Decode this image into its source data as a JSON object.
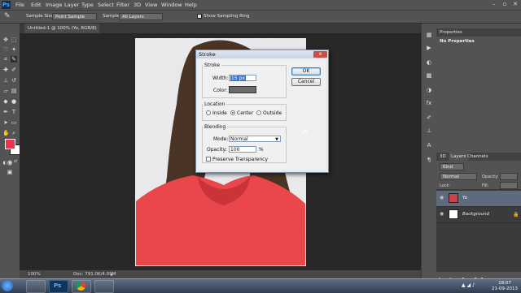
{
  "app": {
    "logo": "Ps"
  },
  "menu": [
    "File",
    "Edit",
    "Image",
    "Layer",
    "Type",
    "Select",
    "Filter",
    "3D",
    "View",
    "Window",
    "Help"
  ],
  "options_bar": {
    "sample_size_label": "Sample Size:",
    "sample_size_value": "Point Sample",
    "sample_label": "Sample:",
    "sample_value": "All Layers",
    "show_ring_label": "Show Sampling Ring"
  },
  "document_tab": "Untitled-1 @ 100% (Yo, RGB/8) *",
  "status": {
    "zoom": "100%",
    "doc": "Doc: 791.0K/4.09M"
  },
  "dialog": {
    "title": "Stroke",
    "close": "x",
    "stroke_group": "Stroke",
    "width_label": "Width:",
    "width_value": "15 px",
    "color_label": "Color:",
    "color_swatch": "#6b6b6b",
    "location_group": "Location",
    "location_options": [
      "Inside",
      "Center",
      "Outside"
    ],
    "location_selected": "Center",
    "blending_group": "Blending",
    "mode_label": "Mode:",
    "mode_value": "Normal",
    "opacity_label": "Opacity:",
    "opacity_value": "100",
    "opacity_unit": "%",
    "preserve_label": "Preserve Transparency",
    "ok_label": "OK",
    "cancel_label": "Cancel"
  },
  "properties": {
    "tab": "Properties",
    "empty": "No Properties"
  },
  "layers_panel": {
    "tabs": [
      "3D",
      "Layers",
      "Channels"
    ],
    "kind": "Kind",
    "blend_mode": "Normal",
    "opacity_label": "Opacity:",
    "lock_label": "Lock:",
    "fill_label": "Fill:",
    "layers": [
      {
        "name": "Yo",
        "selected": true
      },
      {
        "name": "Background",
        "selected": false
      }
    ]
  },
  "taskbar": {
    "time": "18:07",
    "date": "21-09-2013"
  },
  "watermark": "tutsdaddy",
  "colors": {
    "foreground": "#e8354b",
    "background": "#ffffff",
    "accent": "#3875d7"
  }
}
